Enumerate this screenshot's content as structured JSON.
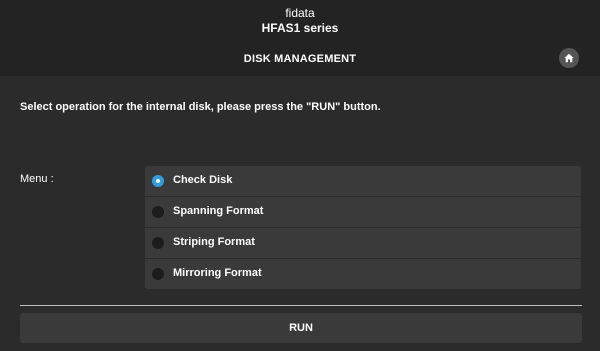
{
  "header": {
    "brand_line1": "fidata",
    "brand_line2": "HFAS1 series",
    "page_title": "DISK MANAGEMENT",
    "home_icon": "home-icon"
  },
  "main": {
    "instruction": "Select operation for the internal disk, please press the \"RUN\" button.",
    "menu_label": "Menu :",
    "options": [
      {
        "label": "Check Disk",
        "selected": true
      },
      {
        "label": "Spanning Format",
        "selected": false
      },
      {
        "label": "Striping Format",
        "selected": false
      },
      {
        "label": "Mirroring Format",
        "selected": false
      }
    ],
    "run_label": "RUN"
  },
  "colors": {
    "accent": "#2f9fe0",
    "background": "#2b2b2b",
    "header_background": "#232323",
    "panel": "#3a3a3a"
  }
}
